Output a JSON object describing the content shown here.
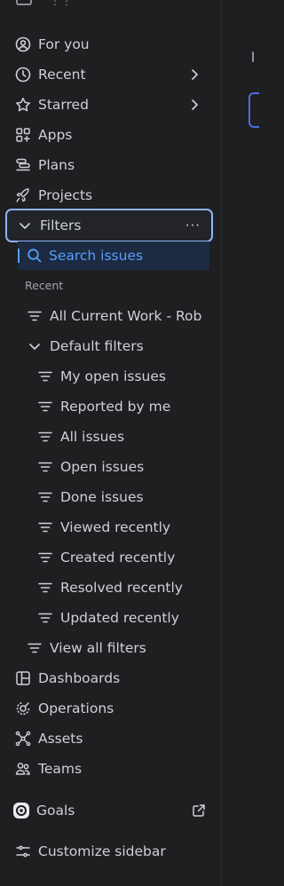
{
  "nav": {
    "for_you": "For you",
    "recent": "Recent",
    "starred": "Starred",
    "apps": "Apps",
    "plans": "Plans",
    "projects": "Projects",
    "filters": "Filters",
    "filters_more": "···",
    "search_issues": "Search issues",
    "recent_heading": "Recent",
    "all_current_work": "All Current Work - Rob",
    "default_filters": "Default filters",
    "default_filter_items": [
      "My open issues",
      "Reported by me",
      "All issues",
      "Open issues",
      "Done issues",
      "Viewed recently",
      "Created recently",
      "Resolved recently",
      "Updated recently"
    ],
    "view_all_filters": "View all filters",
    "dashboards": "Dashboards",
    "operations": "Operations",
    "assets": "Assets",
    "teams": "Teams",
    "goals": "Goals",
    "customize_sidebar": "Customize sidebar"
  },
  "colors": {
    "background": "#1f1f21",
    "text": "#cdd1d7",
    "accent": "#579dff",
    "selected_border": "#8fb4f5",
    "search_bg": "#1c2b41"
  },
  "icons": {
    "for_you": "user-circle-icon",
    "recent": "clock-icon",
    "starred": "star-icon",
    "apps": "apps-grid-icon",
    "plans": "plans-icon",
    "projects": "rocket-icon",
    "filters": "chevron-down-icon",
    "search": "search-icon",
    "filter": "filter-lines-icon",
    "dashboards": "dashboard-icon",
    "operations": "operations-icon",
    "assets": "assets-icon",
    "teams": "teams-icon",
    "goals": "goals-icon",
    "external": "external-link-icon",
    "customize": "sliders-icon"
  }
}
